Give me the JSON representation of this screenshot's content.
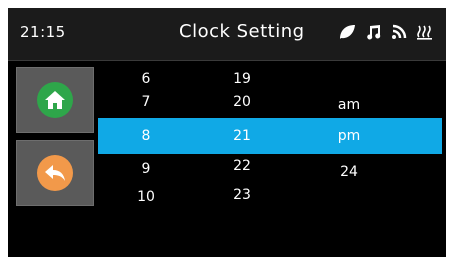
{
  "status_bar": {
    "time": "21:15",
    "title": "Clock Setting",
    "icons": [
      "leaf-icon",
      "music-note-icon",
      "wifi-icon",
      "steam-icon"
    ]
  },
  "side_buttons": {
    "home": {
      "icon": "home-icon"
    },
    "back": {
      "icon": "back-arrow-icon"
    }
  },
  "picker": {
    "hours": [
      "6",
      "7",
      "8",
      "9",
      "10"
    ],
    "minutes": [
      "19",
      "20",
      "21",
      "22",
      "23"
    ],
    "period": [
      "am",
      "pm",
      "24"
    ],
    "selected": {
      "hour": "8",
      "minute": "21",
      "period": "pm"
    }
  },
  "colors": {
    "highlight": "#10a9e6",
    "home": "#2ea64a",
    "back": "#f2994a"
  }
}
